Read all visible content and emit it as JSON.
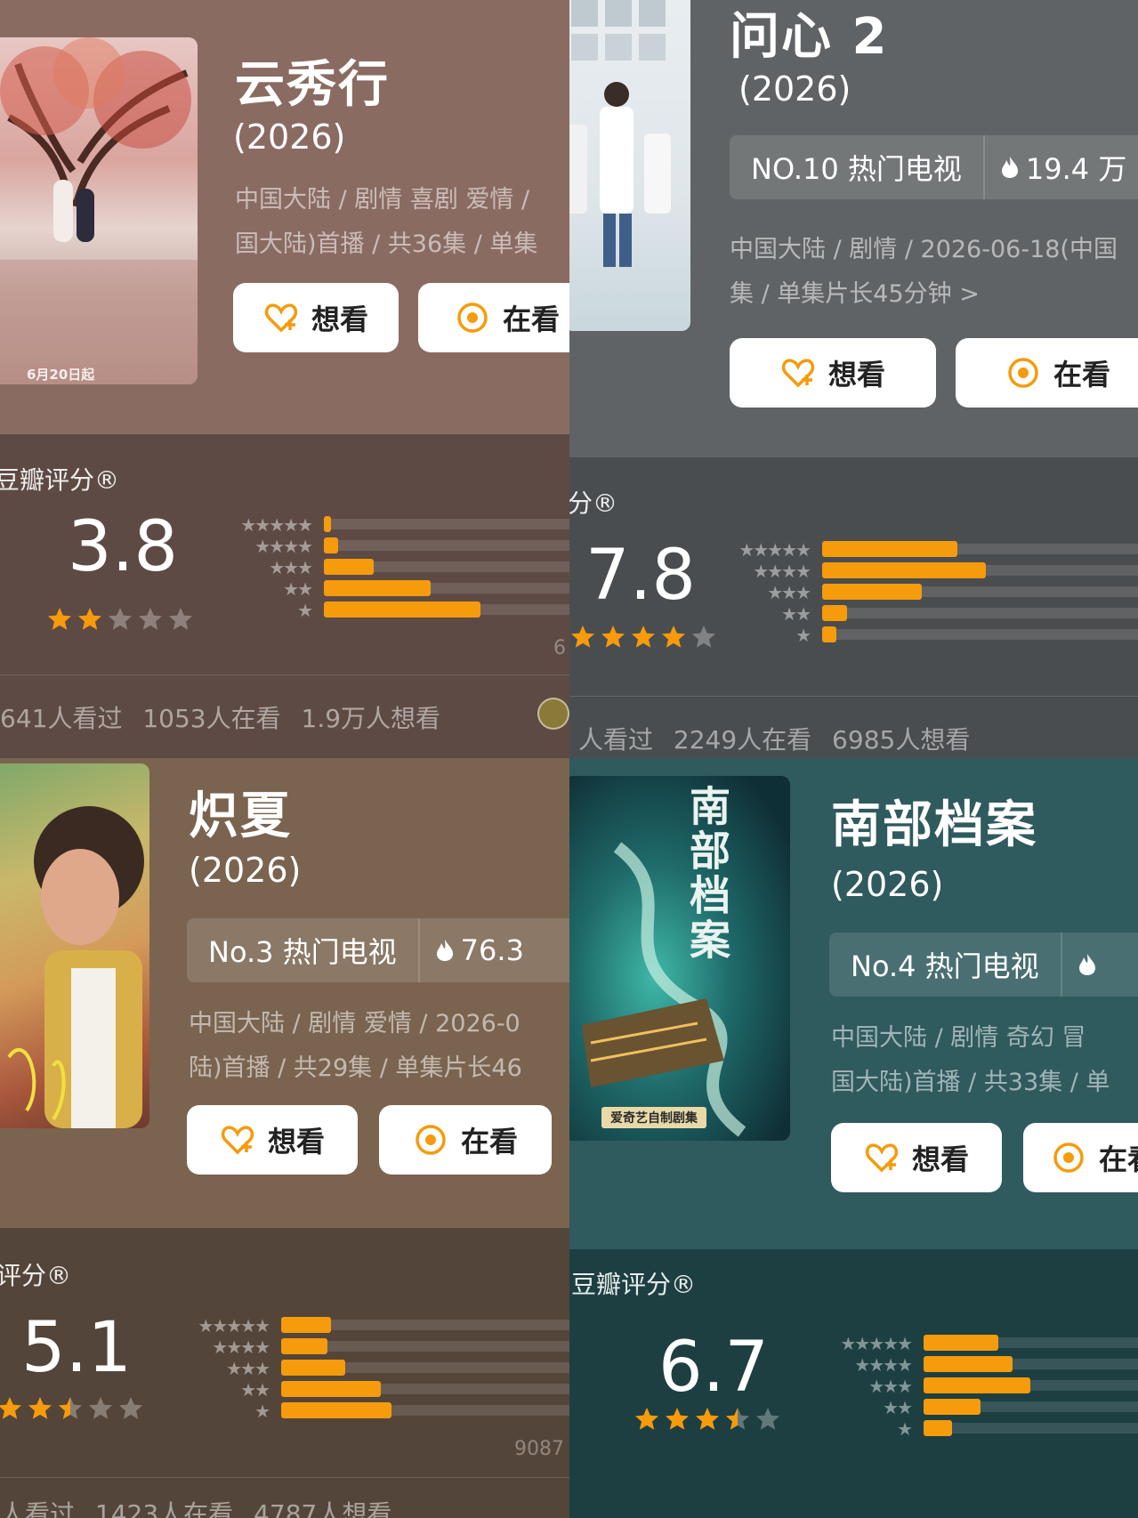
{
  "colors": {
    "accent": "#f59b0c",
    "button_bg": "#ffffff"
  },
  "common": {
    "want_label": "想看",
    "watching_label": "在看"
  },
  "cards": [
    {
      "title": "云秀行",
      "year": "(2026)",
      "meta_line1": "中国大陆 / 剧情 喜剧 爱情 /",
      "meta_line2": "国大陆)首播 / 共36集 / 单集",
      "poster_text": "6月20日起",
      "rating_label": "豆瓣评分®",
      "score": "3.8",
      "star_rating": 2,
      "distribution": [
        2,
        4,
        14,
        30,
        44
      ],
      "count_text": "6",
      "stats": "641人看过   1053人在看   1.9万人想看"
    },
    {
      "title": "问心 2",
      "year": "(2026)",
      "rank": "NO.10 热门电视",
      "heat": "19.4 万",
      "meta_line1": "中国大陆 / 剧情 / 2026-06-18(中国",
      "meta_line2": "集 / 单集片长45分钟 >",
      "rating_label": "分®",
      "score": "7.8",
      "star_rating": 4,
      "distribution": [
        38,
        46,
        28,
        7,
        4
      ],
      "stats": "人看过   2249人在看   6985人想看"
    },
    {
      "title": "炽夏",
      "year": "(2026)",
      "rank": "No.3 热门电视",
      "heat": "76.3",
      "meta_line1": "中国大陆 / 剧情 爱情 / 2026-0",
      "meta_line2": "陆)首播 / 共29集 / 单集片长46",
      "rating_label": "评分®",
      "score": "5.1",
      "star_rating": 2.5,
      "distribution": [
        14,
        13,
        18,
        28,
        31
      ],
      "count_text": "9087",
      "stats": "人看过   1423人在看   4787人想看"
    },
    {
      "title": "南部档案",
      "year": "(2026)",
      "rank": "No.4 热门电视",
      "meta_line1": "中国大陆 / 剧情 奇幻 冒",
      "meta_line2": "国大陆)首播 / 共33集 / 单",
      "poster_title": "南部档案",
      "poster_tag": "爱奇艺自制剧集",
      "rating_label": "豆瓣评分®",
      "score": "6.7",
      "star_rating": 3.5,
      "distribution": [
        21,
        25,
        30,
        16,
        8
      ]
    }
  ]
}
